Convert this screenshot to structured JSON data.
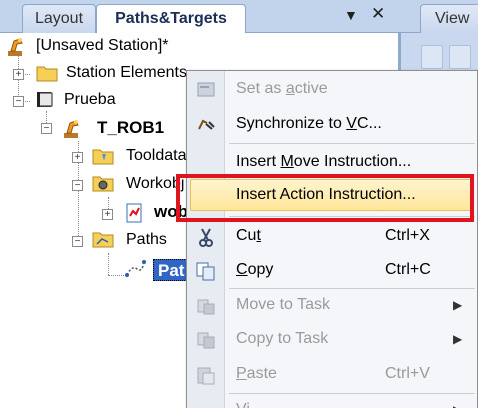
{
  "tabs": {
    "layout": "Layout",
    "paths_targets": "Paths&Targets",
    "view": "View",
    "pin_glyph": "▼",
    "close_glyph": "✕"
  },
  "tree": {
    "station": "[Unsaved Station]*",
    "station_elements": "Station Elements",
    "prueba": "Prueba",
    "robot": "T_ROB1",
    "tooldata": "Tooldata",
    "workobjects": "Workobj",
    "wobj": "wob",
    "paths": "Paths",
    "path_selected": "Pat",
    "icons": [
      "robot-station-icon",
      "folder-icon",
      "book-icon",
      "robot-icon",
      "tooldata-icon",
      "workobject-icon",
      "wobj-icon",
      "paths-folder-icon",
      "path-icon"
    ]
  },
  "context_menu": {
    "items": [
      {
        "id": "set_active",
        "pre": "Set as ",
        "u": "a",
        "post": "ctive",
        "enabled": false,
        "icon": "set-active-icon"
      },
      {
        "id": "sync",
        "pre": "Synchronize to ",
        "u": "V",
        "post": "C...",
        "enabled": true,
        "icon": "synchronize-icon"
      },
      {
        "id": "insert_move",
        "pre": "Insert ",
        "u": "M",
        "post": "ove Instruction...",
        "enabled": true
      },
      {
        "id": "insert_action",
        "pre": "Insert Action Instruction...",
        "u": "",
        "post": "",
        "enabled": true,
        "highlighted": true
      },
      {
        "id": "cut",
        "pre": "Cu",
        "u": "t",
        "post": "",
        "shortcut": "Ctrl+X",
        "enabled": true,
        "icon": "scissors-icon"
      },
      {
        "id": "copy",
        "pre": "",
        "u": "C",
        "post": "opy",
        "shortcut": "Ctrl+C",
        "enabled": true,
        "icon": "copy-icon"
      },
      {
        "id": "move_to_task",
        "pre": "Move to Task",
        "u": "",
        "post": "",
        "enabled": false,
        "submenu": true,
        "icon": "move-to-task-icon"
      },
      {
        "id": "copy_to_task",
        "pre": "Copy to Task",
        "u": "",
        "post": "",
        "enabled": false,
        "submenu": true,
        "icon": "copy-to-task-icon"
      },
      {
        "id": "paste",
        "pre": "",
        "u": "P",
        "post": "aste",
        "shortcut": "Ctrl+V",
        "enabled": false,
        "icon": "paste-icon"
      },
      {
        "id": "view",
        "pre": "Vi",
        "u": "",
        "post": "",
        "enabled": false,
        "submenu": true
      }
    ]
  },
  "colors": {
    "highlight_border": "#e0141e",
    "hover_fill": "#ffe699",
    "disabled_text": "#9a9a9a",
    "tab_strip": "#c2d3ec"
  }
}
